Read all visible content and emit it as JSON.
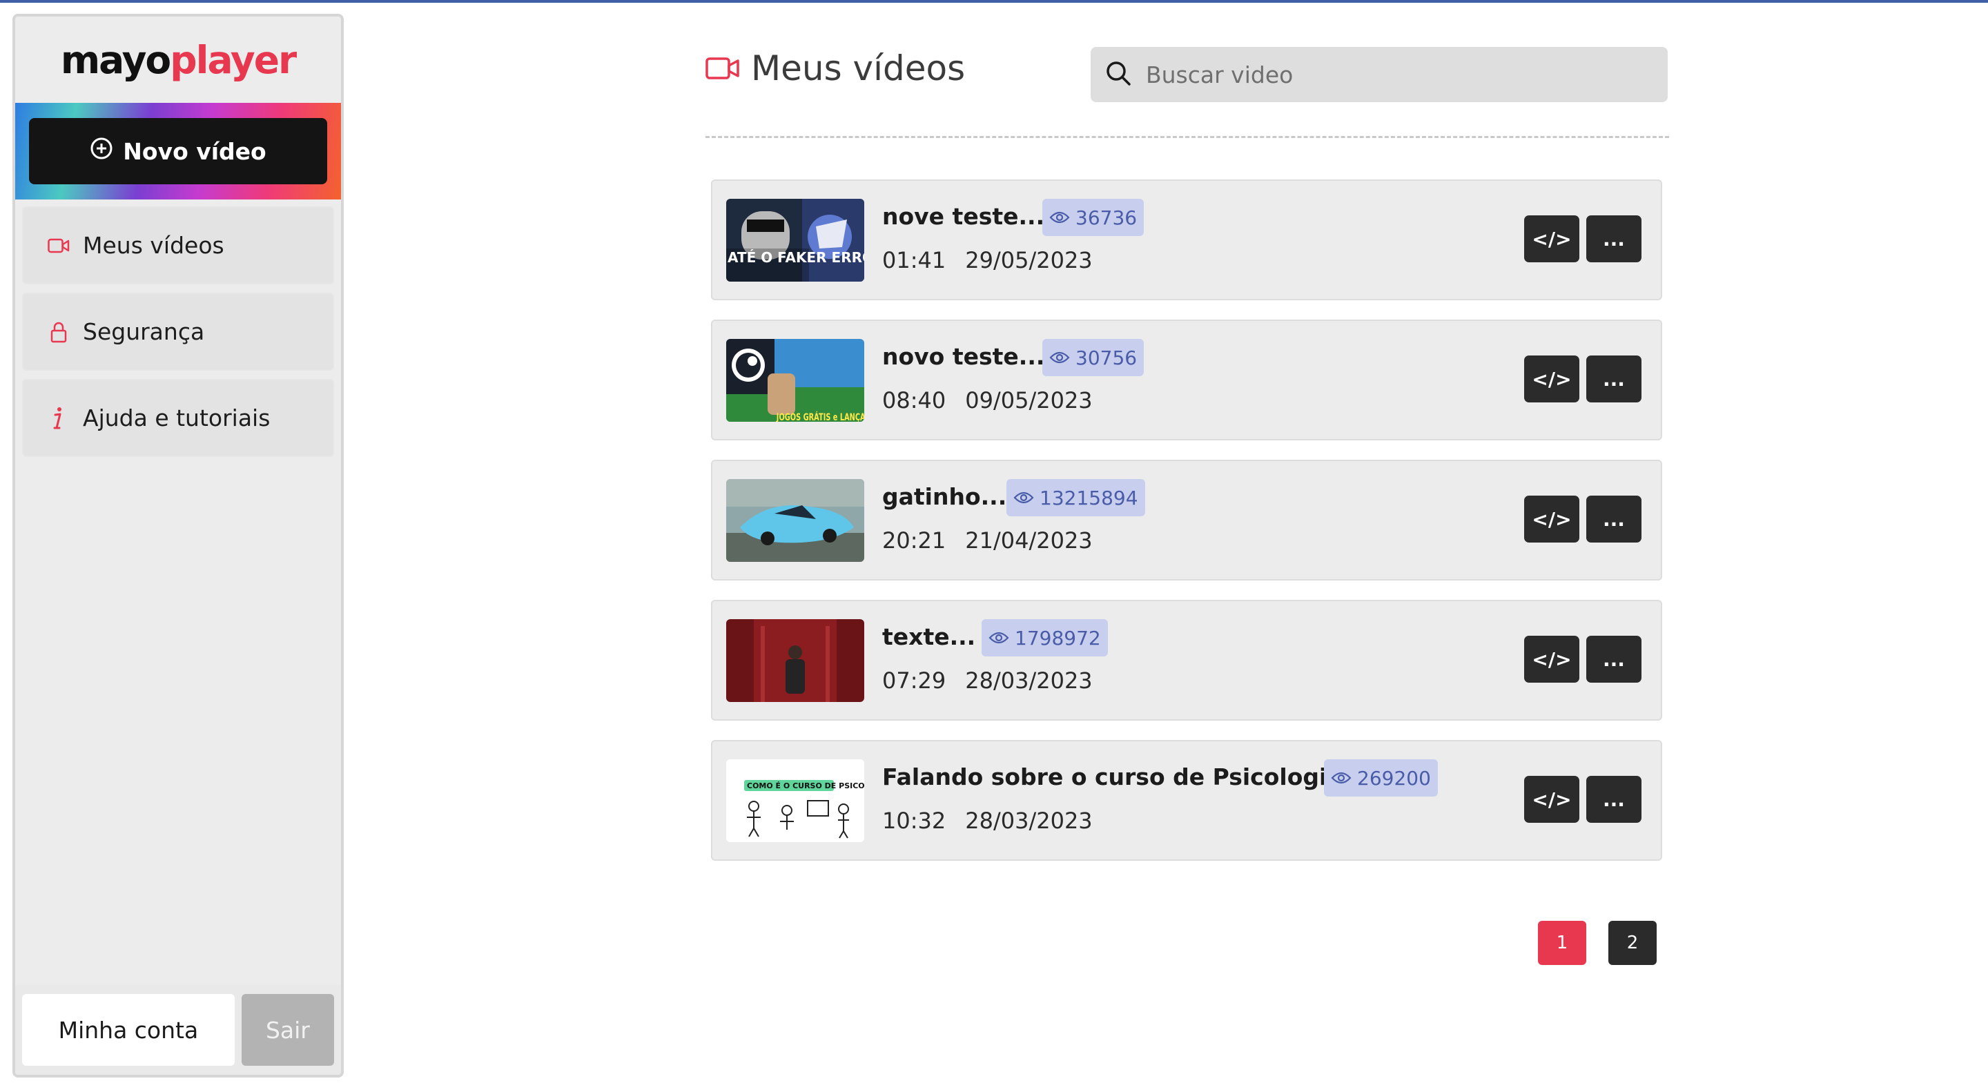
{
  "brand": {
    "part1": "mayo",
    "part2": "player"
  },
  "sidebar": {
    "new_video_label": "Novo vídeo",
    "items": [
      {
        "label": "Meus vídeos",
        "icon": "video-camera-icon"
      },
      {
        "label": "Segurança",
        "icon": "lock-icon"
      },
      {
        "label": "Ajuda e tutoriais",
        "icon": "info-icon"
      }
    ],
    "account_label": "Minha conta",
    "exit_label": "Sair"
  },
  "header": {
    "title": "Meus vídeos",
    "search_placeholder": "Buscar video"
  },
  "videos": [
    {
      "title": "nove teste...",
      "views": "36736",
      "duration": "01:41",
      "date": "29/05/2023",
      "thumb_text": "ATÉ O FAKER ERROU"
    },
    {
      "title": "novo teste...",
      "views": "30756",
      "duration": "08:40",
      "date": "09/05/2023",
      "thumb_text": "JOGOS GRÁTIS e LANÇAMENTOS"
    },
    {
      "title": "gatinho...",
      "views": "13215894",
      "duration": "20:21",
      "date": "21/04/2023",
      "thumb_text": ""
    },
    {
      "title": "texte...",
      "views": "1798972",
      "duration": "07:29",
      "date": "28/03/2023",
      "thumb_text": ""
    },
    {
      "title": "Falando sobre o curso de Psicologia...",
      "views": "269200",
      "duration": "10:32",
      "date": "28/03/2023",
      "thumb_text": "COMO É O CURSO DE PSICOLOGIA?"
    }
  ],
  "actions": {
    "embed_label": "</>",
    "more_label": "..."
  },
  "pagination": {
    "pages": [
      "1",
      "2"
    ],
    "active": "1"
  },
  "colors": {
    "accent": "#e8384f",
    "dark": "#2b2b2b",
    "views_bg": "#c8cfee",
    "views_text": "#4a5ba8"
  }
}
